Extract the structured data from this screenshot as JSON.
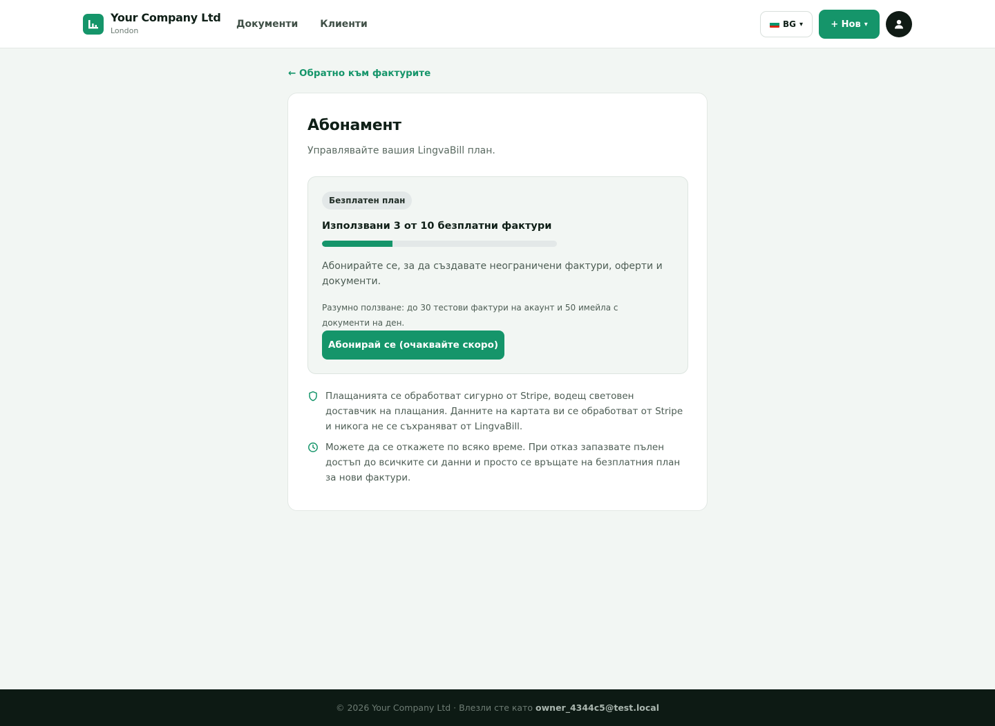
{
  "header": {
    "company_name": "Your Company Ltd",
    "company_city": "London",
    "nav": [
      {
        "label": "Документи"
      },
      {
        "label": "Клиенти"
      }
    ],
    "language": {
      "code": "BG",
      "caret": "▾",
      "flag": "bulgaria-flag"
    },
    "new_button": {
      "label": "+ Нов",
      "caret": "▾"
    },
    "avatar_icon": "user-icon"
  },
  "back_link": "← Обратно към фактурите",
  "card": {
    "title": "Абонамент",
    "subtitle": "Управлявайте вашия LingvaBill план.",
    "plan": {
      "badge": "Безплатен план",
      "usage_text": "Използвани 3 от 10 безплатни фактури",
      "used": 3,
      "limit": 10,
      "description": "Абонирайте се, за да създавате неограничени фактури, оферти и документи.",
      "fair_use": "Разумно ползване: до 30 тестови фактури на акаунт и 50 имейла с документи на ден.",
      "subscribe_label": "Абонирай се (очаквайте скоро)"
    },
    "info": [
      {
        "icon": "shield-icon",
        "text": "Плащанията се обработват сигурно от Stripe, водещ световен доставчик на плащания. Данните на картата ви се обработват от Stripe и никога не се съхраняват от LingvaBill."
      },
      {
        "icon": "clock-icon",
        "text": "Можете да се откажете по всяко време. При отказ запазвате пълен достъп до всичките си данни и просто се връщате на безплатния план за нови фактури."
      }
    ]
  },
  "footer": {
    "text": "© 2026 Your Company Ltd · Влезли сте като",
    "email": "owner_4344c5@test.local"
  },
  "colors": {
    "accent": "#15956a",
    "background": "#f2f6f3",
    "footer_bg": "#0d1a14"
  }
}
